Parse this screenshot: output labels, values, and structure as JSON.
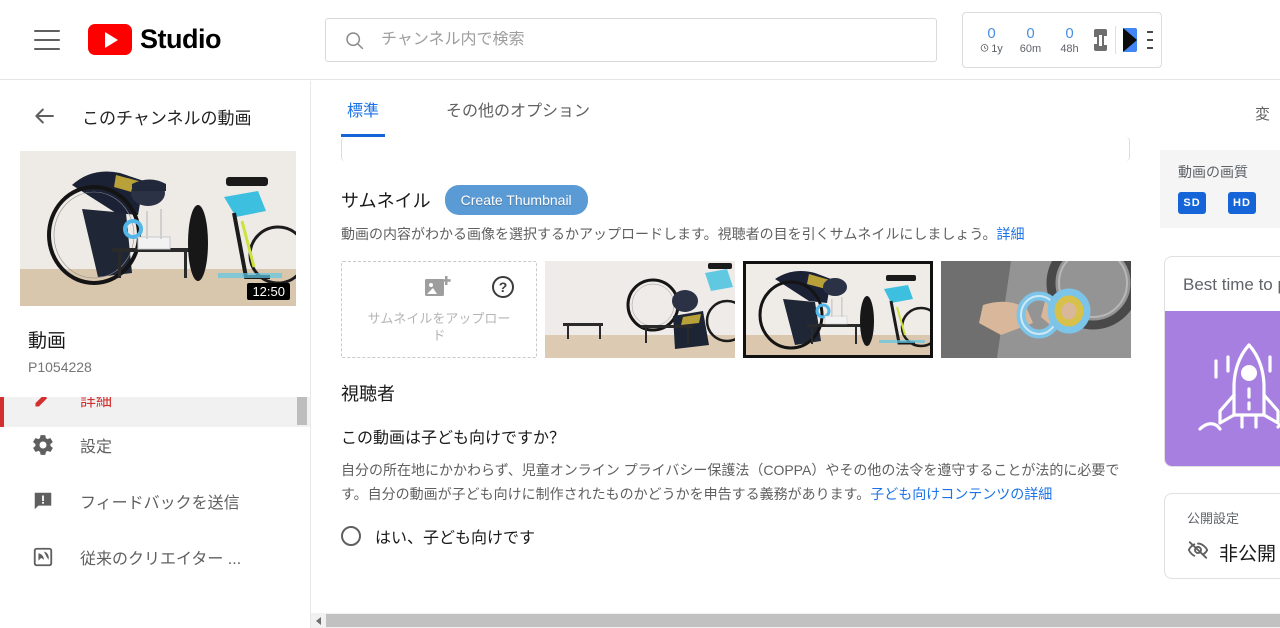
{
  "topbar": {
    "menu_icon": "hamburger-icon",
    "brand": "Studio",
    "logo_icon": "youtube-play-icon",
    "search": {
      "placeholder": "チャンネル内で検索",
      "value": "",
      "icon": "search-icon"
    },
    "stats": [
      {
        "num": "0",
        "label": "1y",
        "has_clock": true
      },
      {
        "num": "0",
        "label": "60m",
        "has_clock": false
      },
      {
        "num": "0",
        "label": "48h",
        "has_clock": false
      }
    ],
    "bars_icon": "bar-chart-icon",
    "iq_icon": "iq-play-icon",
    "right_menu_icon": "hamburger-icon"
  },
  "sidebar": {
    "back_icon": "back-arrow-icon",
    "title": "このチャンネルの動画",
    "thumbnail": {
      "duration": "12:50",
      "name": "thumbnail-preview"
    },
    "video_label": "動画",
    "video_name": "P1054228",
    "items": [
      {
        "label": "詳細",
        "icon": "details-icon",
        "name": "sidebar-item-details",
        "active": true
      },
      {
        "label": "設定",
        "icon": "gear-icon",
        "name": "sidebar-item-settings",
        "active": false
      },
      {
        "label": "フィードバックを送信",
        "icon": "feedback-icon",
        "name": "sidebar-item-feedback",
        "active": false
      },
      {
        "label": "従来のクリエイター ...",
        "icon": "legacy-creator-icon",
        "name": "sidebar-item-legacy-creator",
        "active": false
      }
    ]
  },
  "main": {
    "tabs": [
      {
        "label": "標準",
        "active": true
      },
      {
        "label": "その他のオプション",
        "active": false
      }
    ],
    "thumbnail_section": {
      "title": "サムネイル",
      "create_button": "Create Thumbnail",
      "description": "動画の内容がわかる画像を選択するかアップロードします。視聴者の目を引くサムネイルにしましょう。",
      "description_link": "詳細",
      "upload_label": "サムネイルをアップロード",
      "upload_icon": "add-image-icon",
      "help_icon": "help-question-icon",
      "thumbnails": [
        {
          "name": "thumbnail-option-1",
          "selected": false
        },
        {
          "name": "thumbnail-option-2",
          "selected": true
        },
        {
          "name": "thumbnail-option-3",
          "selected": false
        }
      ]
    },
    "audience_section": {
      "title": "視聴者",
      "question": "この動画は子ども向けですか？",
      "paragraph": "自分の所在地にかかわらず、児童オンライン プライバシー保護法（COPPA）やその他の法令を遵守することが法的に必要です。自分の動画が子ども向けに制作されたものかどうかを申告する義務があります。",
      "paragraph_link": "子ども向けコンテンツの詳細",
      "radio_option": "はい、子ども向けです"
    }
  },
  "rightpanel": {
    "change_label": "変",
    "quality": {
      "title": "動画の画質",
      "badges": [
        "SD",
        "HD"
      ]
    },
    "best_time_card": {
      "title": "Best time to p",
      "image_icon": "rocket-icon",
      "bg_color": "#a77fe0"
    },
    "visibility": {
      "title": "公開設定",
      "icon": "eye-off-icon",
      "value": "非公開"
    }
  },
  "scrollbars": {
    "horizontal_left_arrow": "scroll-left-arrow-icon"
  },
  "colors": {
    "brand_red": "#ff0000",
    "accent_blue": "#1a73e8",
    "tab_underline": "#1565d8",
    "create_button": "#5b9bd5",
    "active_red": "#d32f2f",
    "purple": "#a77fe0"
  }
}
